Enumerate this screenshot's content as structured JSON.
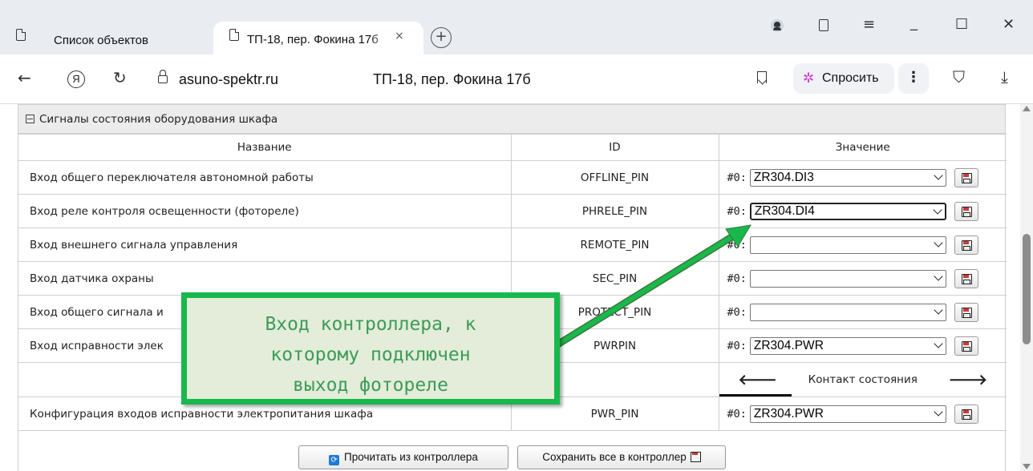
{
  "browser": {
    "tabs": [
      {
        "label": "Список объектов",
        "active": false
      },
      {
        "label": "ТП-18, пер. Фокина 17б",
        "active": true
      }
    ],
    "tab_close": "×",
    "new_tab": "+",
    "url": "asuno-spektr.ru",
    "page_title": "ТП-18, пер. Фокина 17б",
    "ask_label": "Спросить",
    "yandex_glyph": "Я",
    "menu_glyph": "⋮",
    "back_glyph": "←",
    "reload_glyph": "↻",
    "download_glyph": "⤓",
    "window_controls": {
      "minimize": "_",
      "maximize": "☐",
      "close": "✕",
      "menu": "≡"
    }
  },
  "section": {
    "title": "Сигналы состояния оборудования шкафа",
    "columns": [
      "Название",
      "ID",
      "Значение"
    ],
    "rows": [
      {
        "name": "Вход общего переключателя автономной работы",
        "id": "OFFLINE_PIN",
        "prefix": "#0:",
        "value": "ZR304.DI3"
      },
      {
        "name": "Вход реле контроля освещенности (фотореле)",
        "id": "PHRELE_PIN",
        "prefix": "#0:",
        "value": "ZR304.DI4",
        "focused": true
      },
      {
        "name": "Вход внешнего сигнала управления",
        "id": "REMOTE_PIN",
        "prefix": "#0:",
        "value": ""
      },
      {
        "name": "Вход датчика охраны",
        "id": "SEC_PIN",
        "prefix": "#0:",
        "value": ""
      },
      {
        "name": "Вход общего сигнала и",
        "id": "PROTECT_PIN",
        "prefix": "#0:",
        "value": ""
      },
      {
        "name": "Вход исправности элек",
        "id": "PWRPIN",
        "prefix": "#0:",
        "value": "ZR304.PWR"
      }
    ],
    "pager": {
      "label": "Контакт состояния",
      "prev": "🡐",
      "next": "🡒"
    },
    "config_row": {
      "name": "Конфигурация входов исправности электропитания шкафа",
      "id": "PWR_PIN",
      "prefix": "#0:",
      "value": "ZR304.PWR"
    }
  },
  "buttons": {
    "read": "Прочитать из контроллера",
    "save_all": "Сохранить все в контроллер"
  },
  "annotation": {
    "text": "Вход контроллера, к\nкоторому подключен\nвыход фотореле",
    "color": "#19b84c",
    "background": "#e3edd9"
  }
}
